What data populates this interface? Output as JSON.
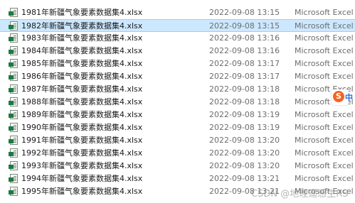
{
  "files": [
    {
      "name": "1981年新疆气象要素数据集4.xlsx",
      "modified": "2022-09-08 13:15",
      "type": "Microsoft Excel ..."
    },
    {
      "name": "1982年新疆气象要素数据集4.xlsx",
      "modified": "2022-09-08 13:15",
      "type": "Microsoft Excel ..."
    },
    {
      "name": "1983年新疆气象要素数据集4.xlsx",
      "modified": "2022-09-08 13:16",
      "type": "Microsoft Excel ..."
    },
    {
      "name": "1984年新疆气象要素数据集4.xlsx",
      "modified": "2022-09-08 13:16",
      "type": "Microsoft Excel ..."
    },
    {
      "name": "1985年新疆气象要素数据集4.xlsx",
      "modified": "2022-09-08 13:17",
      "type": "Microsoft Excel ..."
    },
    {
      "name": "1986年新疆气象要素数据集4.xlsx",
      "modified": "2022-09-08 13:17",
      "type": "Microsoft Excel ..."
    },
    {
      "name": "1987年新疆气象要素数据集4.xlsx",
      "modified": "2022-09-08 13:18",
      "type": "Microsoft Excel ..."
    },
    {
      "name": "1988年新疆气象要素数据集4.xlsx",
      "modified": "2022-09-08 13:18",
      "type": "Microsoft Excel ..."
    },
    {
      "name": "1989年新疆气象要素数据集4.xlsx",
      "modified": "2022-09-08 13:19",
      "type": "Microsoft Excel ..."
    },
    {
      "name": "1990年新疆气象要素数据集4.xlsx",
      "modified": "2022-09-08 13:19",
      "type": "Microsoft Excel ..."
    },
    {
      "name": "1991年新疆气象要素数据集4.xlsx",
      "modified": "2022-09-08 13:20",
      "type": "Microsoft Excel ..."
    },
    {
      "name": "1992年新疆气象要素数据集4.xlsx",
      "modified": "2022-09-08 13:20",
      "type": "Microsoft Excel ..."
    },
    {
      "name": "1993年新疆气象要素数据集4.xlsx",
      "modified": "2022-09-08 13:20",
      "type": "Microsoft Excel ..."
    },
    {
      "name": "1994年新疆气象要素数据集4.xlsx",
      "modified": "2022-09-08 13:21",
      "type": "Microsoft Excel ..."
    },
    {
      "name": "1995年新疆气象要素数据集4.xlsx",
      "modified": "2022-09-08 13:21",
      "type": "Microsoft Excel ..."
    }
  ],
  "selected_index": 1,
  "overlay": {
    "ime_logo_letter": "S",
    "ime_logo_mode": "中",
    "ime_icon": "sogou-ime-icon"
  },
  "watermark": "CSDN @地理遥感生RS",
  "colors": {
    "selection": "#cce8ff",
    "selection_border": "#99d1ff",
    "excel_green": "#1d7a44",
    "ime_orange": "#f26522"
  }
}
